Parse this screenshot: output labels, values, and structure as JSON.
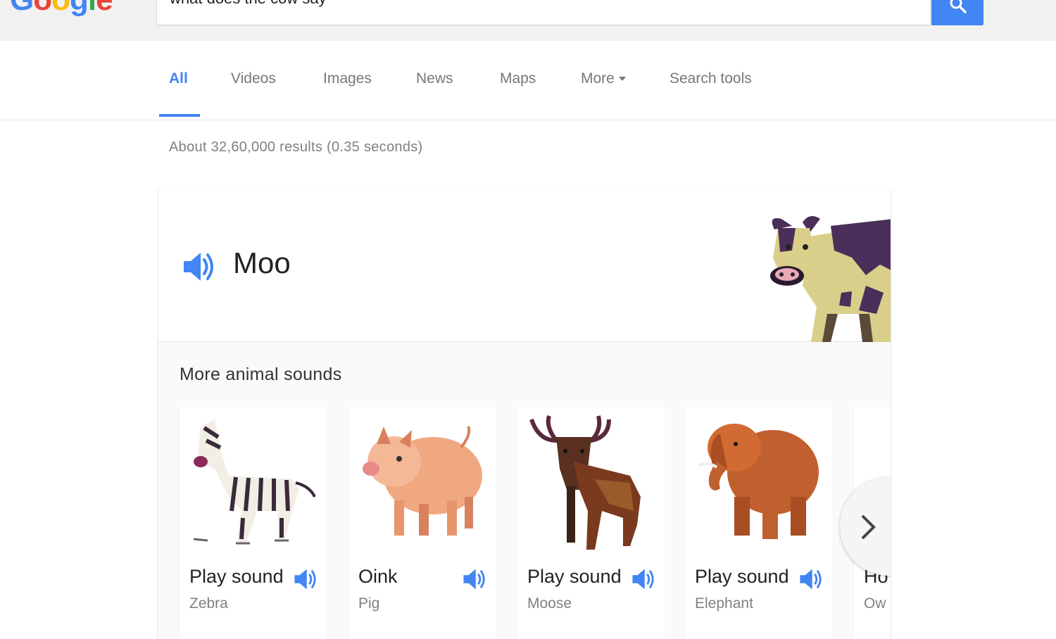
{
  "header": {
    "logo_letters": [
      "G",
      "o",
      "o",
      "g",
      "l",
      "e"
    ],
    "logo_colors": [
      "#4285f4",
      "#ea4335",
      "#fbbc05",
      "#4285f4",
      "#34a853",
      "#ea4335"
    ],
    "search_query": "what does the cow say",
    "search_icon": "search-icon"
  },
  "tabs": {
    "items": [
      {
        "label": "All",
        "active": true
      },
      {
        "label": "Videos"
      },
      {
        "label": "Images"
      },
      {
        "label": "News"
      },
      {
        "label": "Maps"
      },
      {
        "label": "More"
      },
      {
        "label": "Search tools"
      }
    ]
  },
  "results": {
    "stats": "About 32,60,000 results (0.35 seconds)"
  },
  "answer": {
    "sound": "Moo",
    "speaker_icon": "speaker-icon",
    "image": "cow"
  },
  "more_sounds": {
    "title": "More animal sounds",
    "animals": [
      {
        "sound": "Play sound",
        "name": "Zebra"
      },
      {
        "sound": "Oink",
        "name": "Pig"
      },
      {
        "sound": "Play sound",
        "name": "Moose"
      },
      {
        "sound": "Play sound",
        "name": "Elephant"
      },
      {
        "sound": "Ho",
        "name": "Ow"
      }
    ],
    "next_icon": "chevron-right-icon"
  },
  "colors": {
    "accent": "#4285f4",
    "muted_text": "#808080"
  }
}
